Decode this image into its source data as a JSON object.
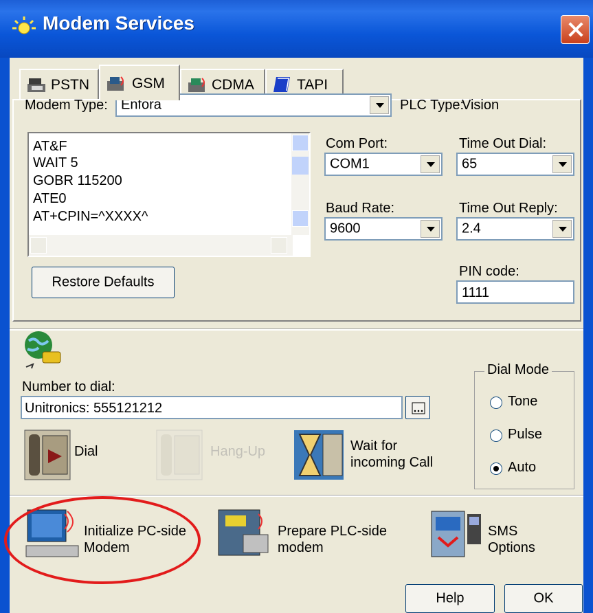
{
  "window": {
    "title": "Modem Services",
    "title_icon": "sun-icon",
    "close_icon": "close-icon"
  },
  "tabs": [
    {
      "label": "PSTN",
      "icon": "phone-modem-icon",
      "active": false
    },
    {
      "label": "GSM",
      "icon": "gsm-modem-icon",
      "active": true
    },
    {
      "label": "CDMA",
      "icon": "cdma-modem-icon",
      "active": false
    },
    {
      "label": "TAPI",
      "icon": "tapi-book-icon",
      "active": false
    }
  ],
  "modem": {
    "type_label": "Modem Type:",
    "type_value": "Enfora",
    "plc_label": "PLC Type:",
    "plc_value": "Vision"
  },
  "init_commands": [
    "AT&F",
    "WAIT 5",
    "GOBR 115200",
    "ATE0",
    "AT+CPIN=^XXXX^"
  ],
  "settings": {
    "com_port_label": "Com Port:",
    "com_port_value": "COM1",
    "timeout_dial_label": "Time Out Dial:",
    "timeout_dial_value": "65",
    "baud_rate_label": "Baud Rate:",
    "baud_rate_value": "9600",
    "timeout_reply_label": "Time Out Reply:",
    "timeout_reply_value": "2.4",
    "pin_label": "PIN code:",
    "pin_value": "1111",
    "restore_label": "Restore Defaults"
  },
  "dialing": {
    "number_label": "Number to dial:",
    "number_value": "Unitronics: 555121212",
    "dial_label": "Dial",
    "hangup_label": "Hang-Up",
    "wait_label_1": "Wait for",
    "wait_label_2": "incoming Call"
  },
  "dial_mode": {
    "title": "Dial Mode",
    "options": [
      {
        "label": "Tone",
        "selected": false
      },
      {
        "label": "Pulse",
        "selected": false
      },
      {
        "label": "Auto",
        "selected": true
      }
    ]
  },
  "actions": {
    "init_pc_1": "Initialize PC-side",
    "init_pc_2": "Modem",
    "prepare_plc_1": "Prepare PLC-side",
    "prepare_plc_2": "modem",
    "sms_1": "SMS",
    "sms_2": "Options"
  },
  "footer": {
    "help_label": "Help",
    "ok_label": "OK"
  },
  "colors": {
    "title_bar": "#0a56d8",
    "dialog_bg": "#ece9d8",
    "annotation": "#e21b1b"
  }
}
